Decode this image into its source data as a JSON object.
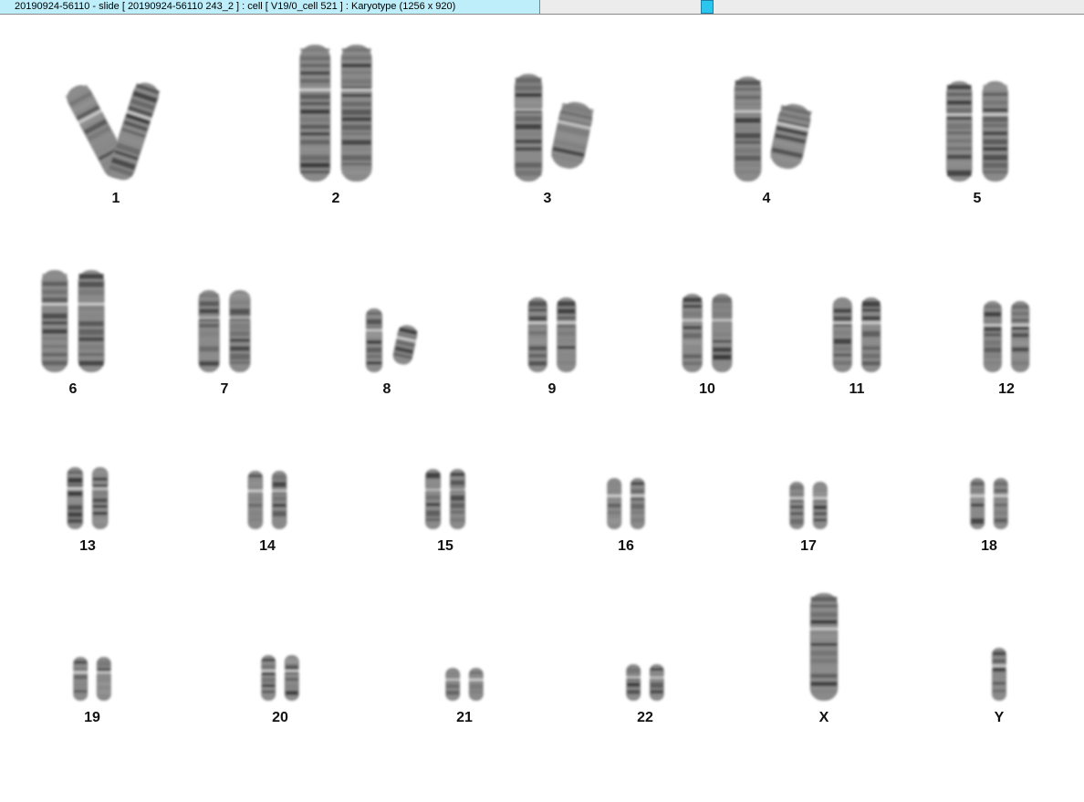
{
  "window": {
    "title": "20190924-56110 - slide [ 20190924-56110 243_2 ] : cell [ V19/0_cell 521 ] : Karyotype  (1256 x 920)",
    "accent_color": "#bfeefb",
    "knob_color": "#2bc6ee"
  },
  "karyotype": {
    "chromosomes": [
      {
        "label": "1",
        "size": 1.0
      },
      {
        "label": "2",
        "size": 0.98
      },
      {
        "label": "3",
        "size": 0.8
      },
      {
        "label": "4",
        "size": 0.76
      },
      {
        "label": "5",
        "size": 0.74
      },
      {
        "label": "6",
        "size": 0.7
      },
      {
        "label": "7",
        "size": 0.64
      },
      {
        "label": "8",
        "size": 0.6
      },
      {
        "label": "9",
        "size": 0.58
      },
      {
        "label": "10",
        "size": 0.56
      },
      {
        "label": "11",
        "size": 0.55
      },
      {
        "label": "12",
        "size": 0.55
      },
      {
        "label": "13",
        "size": 0.46
      },
      {
        "label": "14",
        "size": 0.44
      },
      {
        "label": "15",
        "size": 0.42
      },
      {
        "label": "16",
        "size": 0.38
      },
      {
        "label": "17",
        "size": 0.36
      },
      {
        "label": "18",
        "size": 0.33
      },
      {
        "label": "19",
        "size": 0.25
      },
      {
        "label": "20",
        "size": 0.26
      },
      {
        "label": "21",
        "size": 0.2
      },
      {
        "label": "22",
        "size": 0.22
      },
      {
        "label": "X",
        "size": 0.62
      },
      {
        "label": "Y",
        "size": 0.26
      }
    ]
  }
}
